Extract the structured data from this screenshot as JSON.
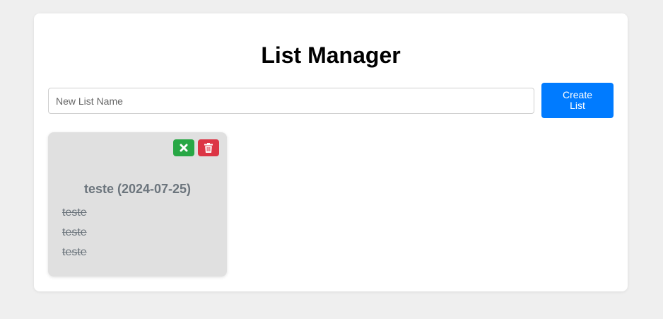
{
  "header": {
    "title": "List Manager"
  },
  "form": {
    "input_placeholder": "New List Name",
    "input_value": "",
    "create_label_line1": "Create",
    "create_label_line2": "List"
  },
  "lists": [
    {
      "title": "teste (2024-07-25)",
      "items": [
        "teste",
        "teste",
        "teste"
      ],
      "completed": true
    }
  ],
  "colors": {
    "primary": "#007bff",
    "success": "#28a745",
    "danger": "#dc3545",
    "card_bg": "#e0e0e0",
    "muted_text": "#6c757d"
  },
  "icons": {
    "complete": "times-icon",
    "delete": "trash-icon"
  }
}
